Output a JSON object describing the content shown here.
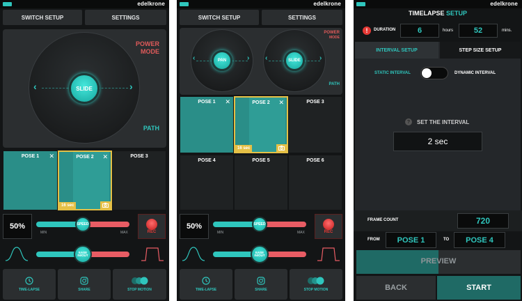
{
  "brand": "edelkrone",
  "colors": {
    "accent": "#2fc6bd",
    "alert": "#e53935",
    "selection": "#e5c046",
    "mode": "#e05a5a"
  },
  "screen1": {
    "switch_setup": "SWITCH SETUP",
    "settings": "SETTINGS",
    "power_mode": [
      "POWER",
      "MODE"
    ],
    "path": "PATH",
    "slide": "SLIDE",
    "poses": [
      {
        "label": "POSE 1",
        "close": "✕"
      },
      {
        "label": "POSE 2",
        "close": "✕",
        "duration": "16 sec",
        "camera": "camera-icon"
      },
      {
        "label": "POSE 3"
      }
    ],
    "speed_pct": "50%",
    "speed_label": "SPEED",
    "speed_value": 0.5,
    "min": "MIN",
    "max": "MAX",
    "rec": "REC",
    "ease_label": [
      "EASE",
      "IN/OUT"
    ],
    "ease_value": 0.5,
    "bottom": [
      {
        "label": "TIME-LAPSE",
        "icon": "clock-icon"
      },
      {
        "label": "SHARE",
        "icon": "instagram-icon"
      },
      {
        "label": "STOP MOTION",
        "icon": "stop-motion-icon"
      }
    ]
  },
  "screen2": {
    "switch_setup": "SWITCH SETUP",
    "settings": "SETTINGS",
    "pan": "PAN",
    "slide": "SLIDE",
    "power_mode": [
      "POWER",
      "MODE"
    ],
    "path": "PATH",
    "poses": [
      {
        "label": "POSE 1",
        "close": "✕"
      },
      {
        "label": "POSE 2",
        "close": "✕",
        "duration": "16 sec",
        "camera": "camera-icon"
      },
      {
        "label": "POSE 3"
      },
      {
        "label": "POSE 4"
      },
      {
        "label": "POSE 5"
      },
      {
        "label": "POSE 6"
      }
    ],
    "speed_pct": "50%",
    "speed_label": "SPEED",
    "speed_value": 0.5,
    "min": "MIN",
    "max": "MAX",
    "rec": "REC",
    "ease_label": [
      "EASE",
      "IN/OUT"
    ],
    "ease_value": 0.5,
    "bottom": [
      {
        "label": "TIME-LAPSE",
        "icon": "clock-icon"
      },
      {
        "label": "SHARE",
        "icon": "instagram-icon"
      },
      {
        "label": "STOP MOTION",
        "icon": "stop-motion-icon"
      }
    ]
  },
  "screen3": {
    "title_main": "TIMELAPSE",
    "title_accent": "SETUP",
    "duration_label": "DURATION",
    "hours_value": "6",
    "hours_unit": "hours",
    "mins_value": "52",
    "mins_unit": "mins.",
    "tab_interval": "INTERVAL SETUP",
    "tab_step": "STEP SIZE SETUP",
    "static_interval": "STATIC INTERVAL",
    "dynamic_interval": "DYNAMIC INTERVAL",
    "toggle_on": false,
    "set_interval": "SET THE INTERVAL",
    "help": "?",
    "interval_value": "2 sec",
    "frame_count_label": "FRAME COUNT",
    "frame_count_value": "720",
    "from_label": "FROM",
    "from_value": "POSE 1",
    "to_label": "TO",
    "to_value": "POSE 4",
    "preview": "PREVIEW",
    "preview_progress": 0.5,
    "back": "BACK",
    "start": "START"
  }
}
